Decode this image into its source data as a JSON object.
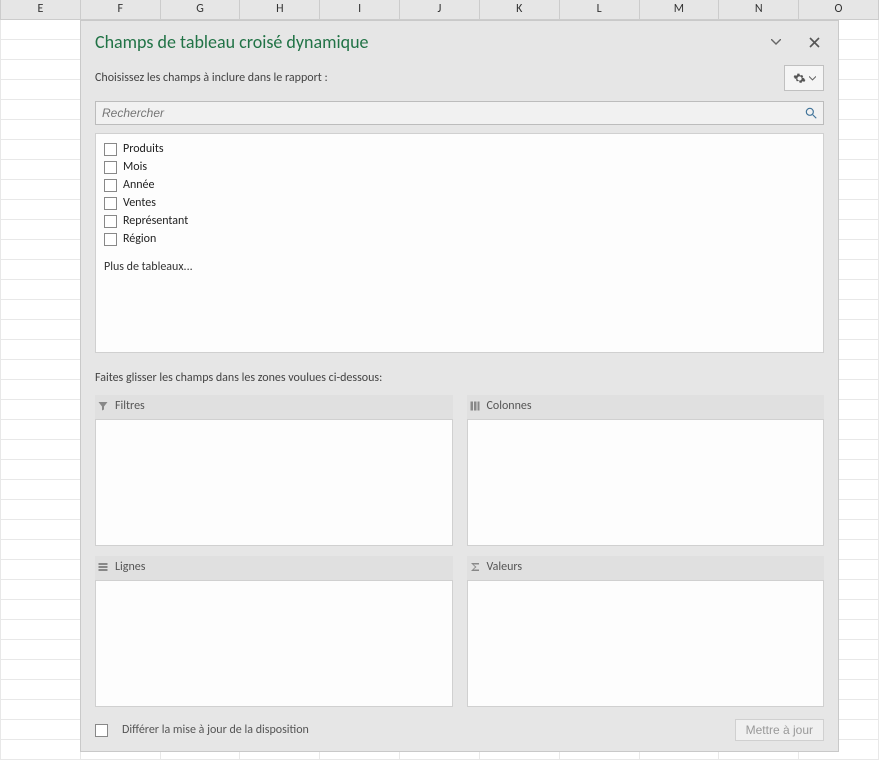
{
  "columns": [
    "E",
    "F",
    "G",
    "H",
    "I",
    "J",
    "K",
    "L",
    "M",
    "N",
    "O"
  ],
  "panel": {
    "title": "Champs de tableau croisé dynamique",
    "instruction": "Choisissez les champs à inclure dans le rapport :",
    "search_placeholder": "Rechercher",
    "fields": [
      {
        "label": "Produits"
      },
      {
        "label": "Mois"
      },
      {
        "label": "Année"
      },
      {
        "label": "Ventes"
      },
      {
        "label": "Représentant"
      },
      {
        "label": "Région"
      }
    ],
    "more_tables": "Plus de tableaux...",
    "drag_instruction": "Faites glisser les champs dans les zones voulues ci-dessous:",
    "areas": {
      "filters": "Filtres",
      "columns": "Colonnes",
      "rows": "Lignes",
      "values": "Valeurs"
    },
    "defer_label": "Différer la mise à jour de la disposition",
    "update_button": "Mettre à jour"
  }
}
